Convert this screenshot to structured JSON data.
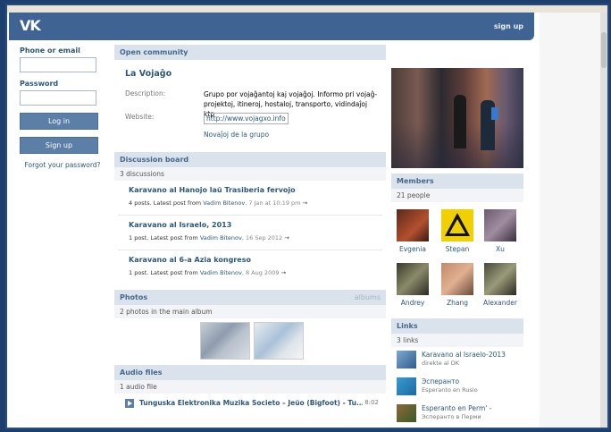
{
  "header": {
    "logo": "VK",
    "signup_link": "sign up"
  },
  "login": {
    "phone_label": "Phone or email",
    "password_label": "Password",
    "login_button": "Log in",
    "signup_button": "Sign up",
    "forgot_link": "Forgot your password?"
  },
  "community": {
    "type_label": "Open community",
    "name": "La Vojaĝo",
    "description_label": "Description:",
    "description": "Grupo por vojaĝantoj kaj vojaĝoj. Informo pri vojaĝ-projektoj, itineroj, hostaloj, transporto, vidindaĵoj ktp",
    "website_label": "Website:",
    "website": "http://www.vojagxo.info",
    "news_link": "Novaĵoj de la grupo"
  },
  "discussion": {
    "header": "Discussion board",
    "count": "3 discussions",
    "topics": [
      {
        "title": "Karavano al Hanojo laŭ Trasiberia fervojo",
        "meta": "4 posts. Latest post from ",
        "author": "Vadim Bitenov",
        "date": ", 7 Jan at 10:19 pm"
      },
      {
        "title": "Karavano al Israelo, 2013",
        "meta": "1 post. Latest post from ",
        "author": "Vadim Bitenov",
        "date": ", 16 Sep 2012"
      },
      {
        "title": "Karavano al 6-a Azia kongreso",
        "meta": "1 post. Latest post from ",
        "author": "Vadim Bitenov",
        "date": ", 8 Aug 2009"
      }
    ]
  },
  "photos": {
    "header": "Photos",
    "albums_link": "albums",
    "count": "2 photos in the main album"
  },
  "audio": {
    "header": "Audio files",
    "count": "1 audio file",
    "track": "Tunguska Elektronika Muzika Societo – Jeŭo (Bigfoot) - Tu...",
    "duration": "8:02"
  },
  "members": {
    "header": "Members",
    "count": "21 people",
    "list": [
      {
        "name": "Evgenia"
      },
      {
        "name": "Stepan"
      },
      {
        "name": "Xu"
      },
      {
        "name": "Andrey"
      },
      {
        "name": "Zhang"
      },
      {
        "name": "Alexander"
      }
    ]
  },
  "links": {
    "header": "Links",
    "count": "3 links",
    "items": [
      {
        "title": "Karavano al Israelo-2013",
        "sub": "direkte al DK"
      },
      {
        "title": "Эсперанто",
        "sub": "Esperanto en Rusio"
      },
      {
        "title": "Esperanto en Perm' -",
        "sub": "Эсперанто в Перми"
      }
    ]
  },
  "colors": {
    "accent": "#3f6494",
    "link": "#2b587a",
    "section_head": "#dae2eb"
  },
  "icons": {
    "play": "play-icon",
    "arrow": "arrow-right-icon"
  }
}
